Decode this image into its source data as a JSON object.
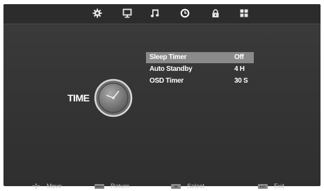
{
  "tabs": [
    {
      "name": "picture",
      "icon": "gear-icon"
    },
    {
      "name": "screen",
      "icon": "monitor-icon"
    },
    {
      "name": "sound",
      "icon": "music-note-icon"
    },
    {
      "name": "time",
      "icon": "clock-icon",
      "selected": true
    },
    {
      "name": "lock",
      "icon": "lock-icon"
    },
    {
      "name": "setup",
      "icon": "grid-icon"
    }
  ],
  "menu": {
    "title": "TIME",
    "items": [
      {
        "label": "Sleep Timer",
        "value": "Off",
        "selected": true
      },
      {
        "label": "Auto Standby",
        "value": "4 H",
        "selected": false
      },
      {
        "label": "OSD Timer",
        "value": "30 S",
        "selected": false
      }
    ]
  },
  "hints": {
    "move": {
      "text": "Move"
    },
    "return": {
      "key": "MENU",
      "text": "Return"
    },
    "select": {
      "key": "OK",
      "text": "Select"
    },
    "exit": {
      "key": "EXIT",
      "text": "Exit"
    }
  },
  "colors": {
    "selected_row": "#8a8a8a",
    "background": "#353535",
    "text": "#ffffff"
  }
}
